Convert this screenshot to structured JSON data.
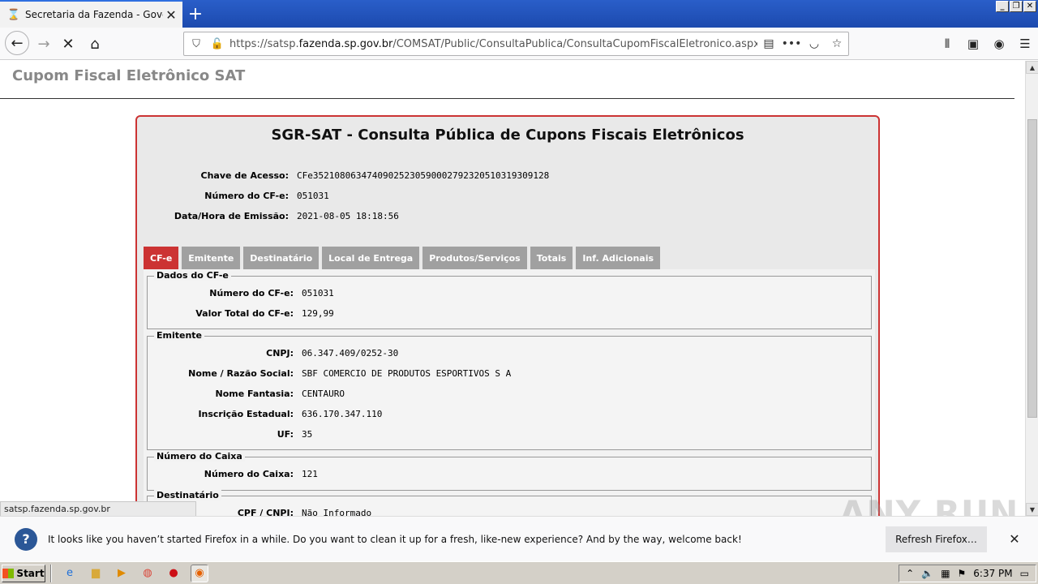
{
  "browser": {
    "tab_title": "Secretaria da Fazenda - Governo do Estado de São Paulo",
    "url_host": "satsp.fazenda.sp.gov.br",
    "url_prefix": "https://satsp.",
    "url_host_bold": "fazenda.sp.gov.br",
    "url_path": "/COMSAT/Public/ConsultaPublica/ConsultaCupomFiscalEletronico.aspx"
  },
  "page": {
    "site_title": "Cupom Fiscal Eletrônico SAT",
    "panel_title": "SGR-SAT - Consulta Pública de Cupons Fiscais Eletrônicos",
    "header_fields": [
      {
        "label": "Chave de Acesso:",
        "value": "CFe35210806347409025230590002792320510319309128"
      },
      {
        "label": "Número do CF-e:",
        "value": "051031"
      },
      {
        "label": "Data/Hora de Emissão:",
        "value": "2021-08-05 18:18:56"
      }
    ],
    "tabs": [
      "CF-e",
      "Emitente",
      "Destinatário",
      "Local de Entrega",
      "Produtos/Serviços",
      "Totais",
      "Inf. Adicionais"
    ],
    "sections": {
      "dados": {
        "legend": "Dados do CF-e",
        "fields": [
          {
            "label": "Número do CF-e:",
            "value": "051031"
          },
          {
            "label": "Valor Total do CF-e:",
            "value": "129,99"
          }
        ]
      },
      "emitente": {
        "legend": "Emitente",
        "fields": [
          {
            "label": "CNPJ:",
            "value": "06.347.409/0252-30"
          },
          {
            "label": "Nome / Razão Social:",
            "value": "SBF COMERCIO DE PRODUTOS ESPORTIVOS S A"
          },
          {
            "label": "Nome Fantasia:",
            "value": "CENTAURO"
          },
          {
            "label": "Inscrição Estadual:",
            "value": "636.170.347.110"
          },
          {
            "label": "UF:",
            "value": "35"
          }
        ]
      },
      "caixa": {
        "legend": "Número do Caixa",
        "fields": [
          {
            "label": "Número do Caixa:",
            "value": "121"
          }
        ]
      },
      "destinatario": {
        "legend": "Destinatário",
        "fields": [
          {
            "label": "CPF / CNPJ:",
            "value": "Não Informado"
          }
        ]
      }
    }
  },
  "status_link": "satsp.fazenda.sp.gov.br",
  "notification": {
    "message": "It looks like you haven’t started Firefox in a while. Do you want to clean it up for a fresh, like-new experience? And by the way, welcome back!",
    "button": "Refresh Firefox…"
  },
  "watermark": "ANY RUN",
  "taskbar": {
    "start_label": "Start",
    "clock": "6:37 PM"
  }
}
